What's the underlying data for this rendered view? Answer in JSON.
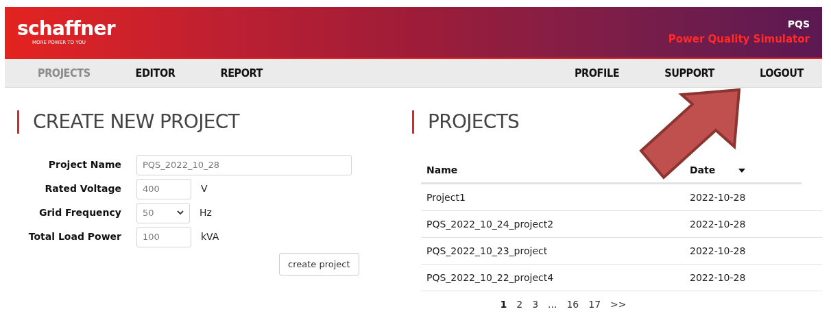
{
  "header": {
    "logo": "schaffner",
    "tagline": "MORE POWER TO YOU",
    "app_short": "PQS",
    "app_name": "Power Quality Simulator"
  },
  "nav": {
    "left": [
      {
        "label": "PROJECTS",
        "selected": true
      },
      {
        "label": "EDITOR",
        "selected": false
      },
      {
        "label": "REPORT",
        "selected": false
      }
    ],
    "right": [
      {
        "label": "PROFILE",
        "selected": false
      },
      {
        "label": "SUPPORT",
        "selected": false
      },
      {
        "label": "LOGOUT",
        "selected": false
      }
    ]
  },
  "create": {
    "title": "CREATE NEW PROJECT",
    "fields": [
      {
        "kind": "text",
        "label": "Project Name",
        "value": "PQS_2022_10_28"
      },
      {
        "kind": "number",
        "label": "Rated Voltage",
        "value": "400",
        "unit": "V"
      },
      {
        "kind": "select",
        "label": "Grid Frequency",
        "value": "50",
        "unit": "Hz"
      },
      {
        "kind": "number",
        "label": "Total Load Power",
        "value": "100",
        "unit": "kVA"
      }
    ],
    "button": "create project"
  },
  "projects": {
    "title": "PROJECTS",
    "columns": [
      "Name",
      "Date"
    ],
    "rows": [
      [
        "Project1",
        "2022-10-28"
      ],
      [
        "PQS_2022_10_24_project2",
        "2022-10-28"
      ],
      [
        "PQS_2022_10_23_project",
        "2022-10-28"
      ],
      [
        "PQS_2022_10_22_project4",
        "2022-10-28"
      ]
    ],
    "pages": [
      {
        "label": "1",
        "selected": true
      },
      {
        "label": "2",
        "selected": false
      },
      {
        "label": "3",
        "selected": false
      },
      {
        "label": "...",
        "selected": false
      },
      {
        "label": "16",
        "selected": false
      },
      {
        "label": "17",
        "selected": false
      },
      {
        "label": ">>",
        "selected": false
      }
    ]
  }
}
